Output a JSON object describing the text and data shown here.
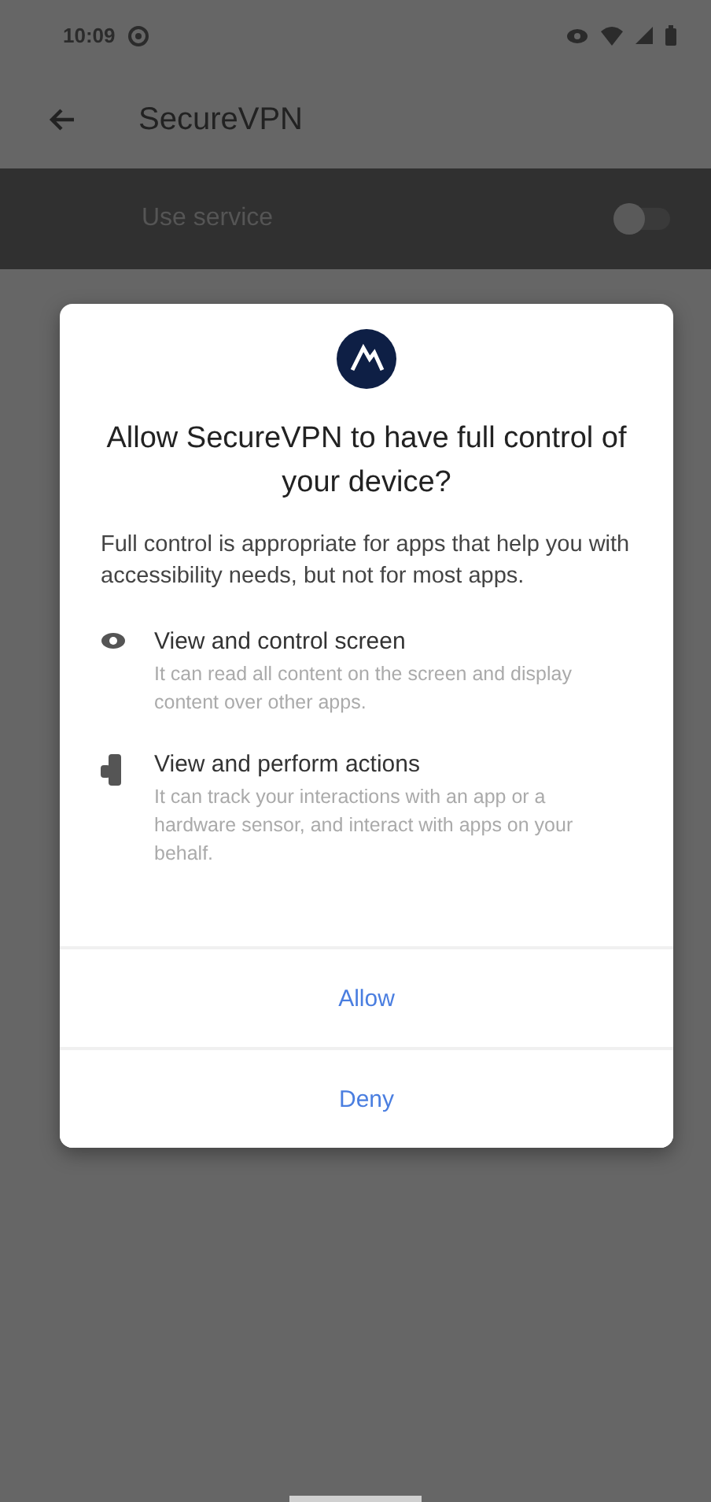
{
  "status_bar": {
    "time": "10:09"
  },
  "app_bar": {
    "title": "SecureVPN"
  },
  "service_row": {
    "label": "Use service",
    "on": false
  },
  "dialog": {
    "title": "Allow SecureVPN to have full control of your device?",
    "body": "Full control is appropriate for apps that help you with accessibility needs, but not for most apps.",
    "permissions": [
      {
        "kind": "eye",
        "title": "View and control screen",
        "description": "It can read all content on the screen and display content over other apps."
      },
      {
        "kind": "hand",
        "title": "View and perform actions",
        "description": "It can track your interactions with an app or a hardware sensor, and interact with apps on your behalf."
      }
    ],
    "buttons": [
      "Allow",
      "Deny"
    ]
  }
}
